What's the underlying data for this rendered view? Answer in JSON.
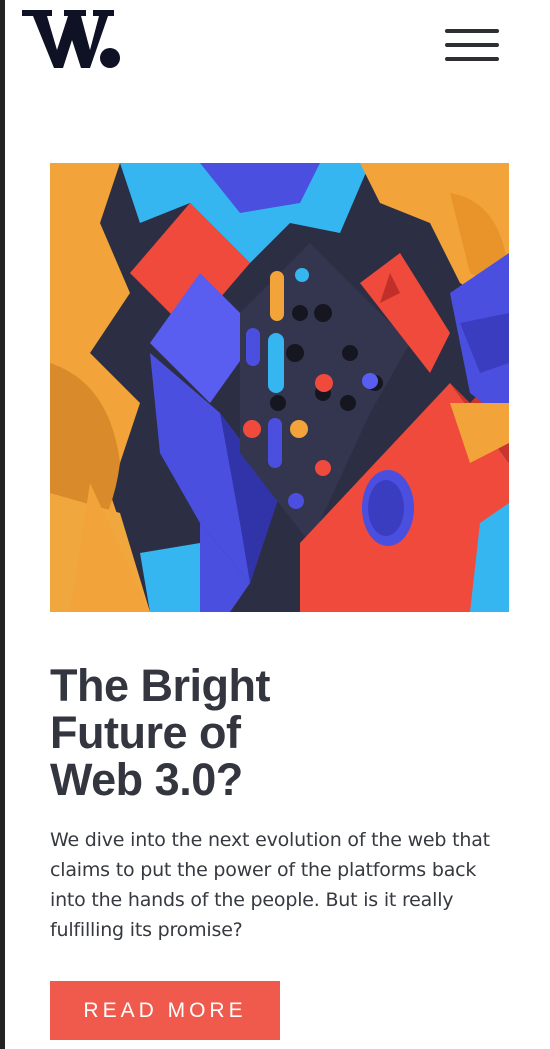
{
  "header": {
    "logo_icon": "w-logo-icon",
    "menu_icon": "hamburger-menu-icon"
  },
  "hero": {
    "image_icon": "abstract-3d-shapes-image"
  },
  "article": {
    "title_line1": "The Bright",
    "title_line2": "Future of",
    "title_line3": "Web 3.0?",
    "description": "We dive into the next evolution of the web that claims to put the power of the platforms back into the hands of the people. But is it really fulfilling its promise?",
    "cta_label": "READ MORE"
  },
  "colors": {
    "accent": "#f05a4d",
    "text": "#33363f",
    "orange": "#f2a33a",
    "blue": "#4b4fe0",
    "cyan": "#35b6f0",
    "red": "#ef4a3c",
    "dark": "#2a2b3d"
  }
}
